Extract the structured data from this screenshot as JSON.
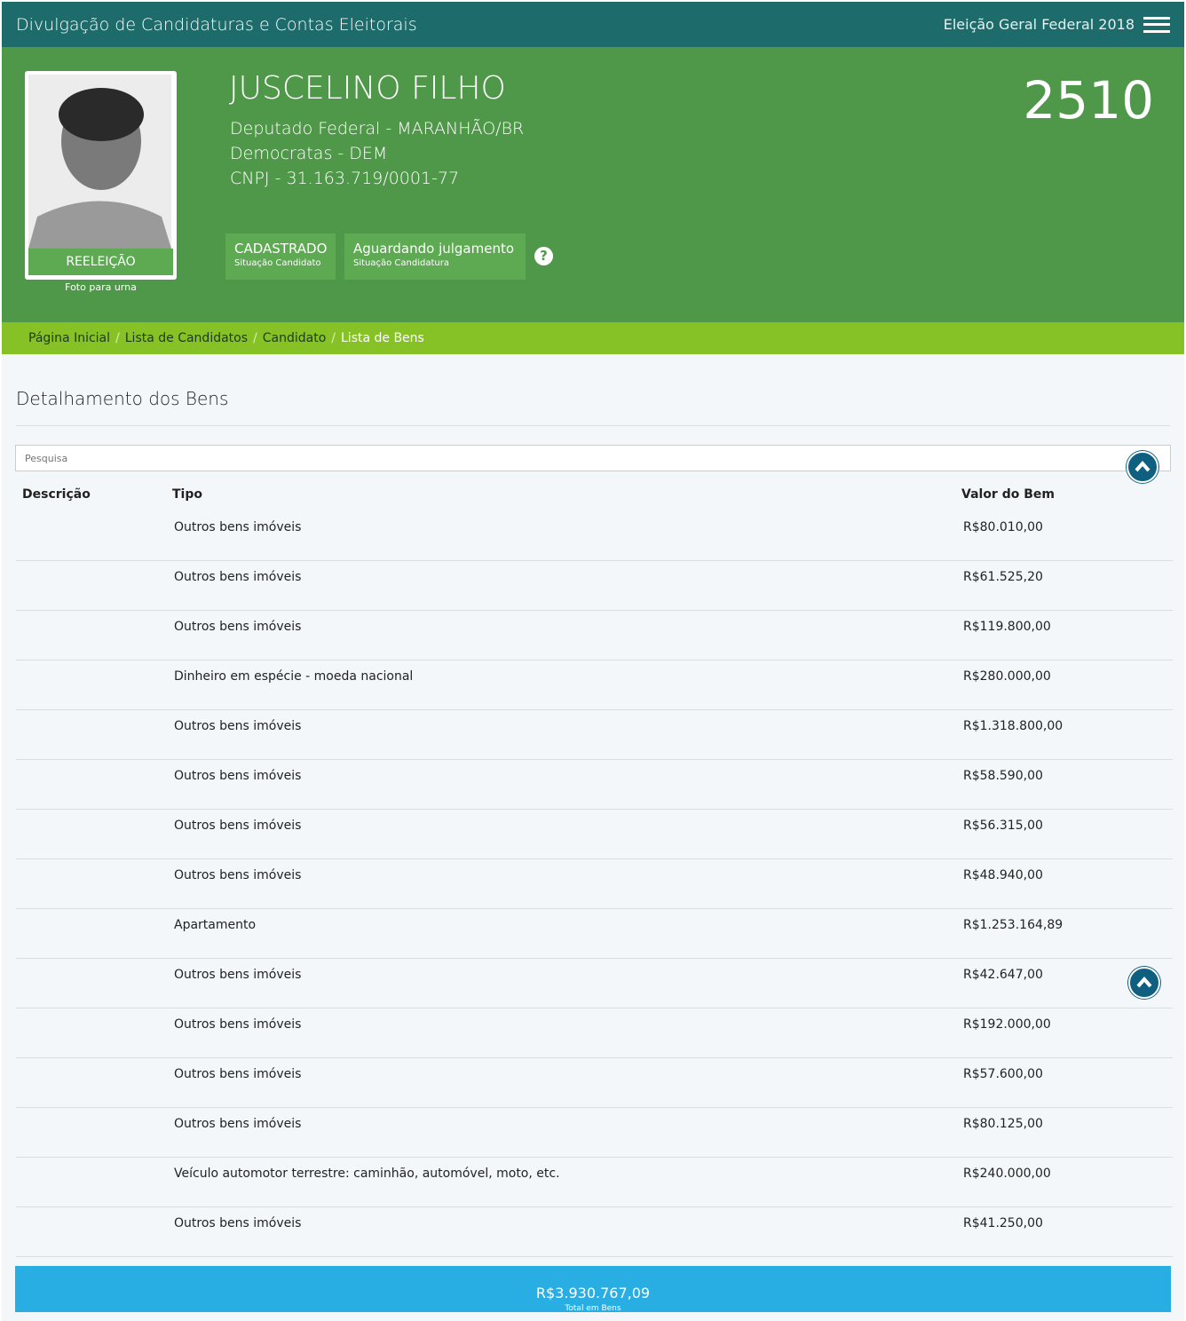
{
  "header": {
    "title": "Divulgação de Candidaturas e Contas Eleitorais",
    "election": "Eleição Geral Federal 2018"
  },
  "candidate": {
    "name": "JUSCELINO FILHO",
    "office": "Deputado Federal - MARANHÃO/BR",
    "party": "Democratas - DEM",
    "cnpj": "CNPJ - 31.163.719/0001-77",
    "number": "2510",
    "photo_badge": "REELEIÇÃO",
    "photo_caption": "Foto para urna",
    "status": [
      {
        "value": "CADASTRADO",
        "label": "Situação Candidato"
      },
      {
        "value": "Aguardando julgamento",
        "label": "Situação Candidatura"
      }
    ]
  },
  "breadcrumb": [
    "Página Inicial",
    "Lista de Candidatos",
    "Candidato",
    "Lista de Bens"
  ],
  "section_title": "Detalhamento dos Bens",
  "search": {
    "placeholder": "Pesquisa"
  },
  "table": {
    "headers": [
      "Descrição",
      "Tipo",
      "Valor do Bem"
    ],
    "rows": [
      {
        "tipo": "Outros bens imóveis",
        "valor": "R$80.010,00"
      },
      {
        "tipo": "Outros bens imóveis",
        "valor": "R$61.525,20"
      },
      {
        "tipo": "Outros bens imóveis",
        "valor": "R$119.800,00"
      },
      {
        "tipo": "Dinheiro em espécie - moeda nacional",
        "valor": "R$280.000,00"
      },
      {
        "tipo": "Outros bens imóveis",
        "valor": "R$1.318.800,00"
      },
      {
        "tipo": "Outros bens imóveis",
        "valor": "R$58.590,00"
      },
      {
        "tipo": "Outros bens imóveis",
        "valor": "R$56.315,00"
      },
      {
        "tipo": "Outros bens imóveis",
        "valor": "R$48.940,00"
      },
      {
        "tipo": "Apartamento",
        "valor": "R$1.253.164,89"
      },
      {
        "tipo": "Outros bens imóveis",
        "valor": "R$42.647,00"
      },
      {
        "tipo": "Outros bens imóveis",
        "valor": "R$192.000,00"
      },
      {
        "tipo": "Outros bens imóveis",
        "valor": "R$57.600,00"
      },
      {
        "tipo": "Outros bens imóveis",
        "valor": "R$80.125,00"
      },
      {
        "tipo": "Veículo automotor terrestre: caminhão, automóvel, moto, etc.",
        "valor": "R$240.000,00"
      },
      {
        "tipo": "Outros bens imóveis",
        "valor": "R$41.250,00"
      }
    ]
  },
  "total": {
    "value": "R$3.930.767,09",
    "label": "Total em Bens"
  }
}
